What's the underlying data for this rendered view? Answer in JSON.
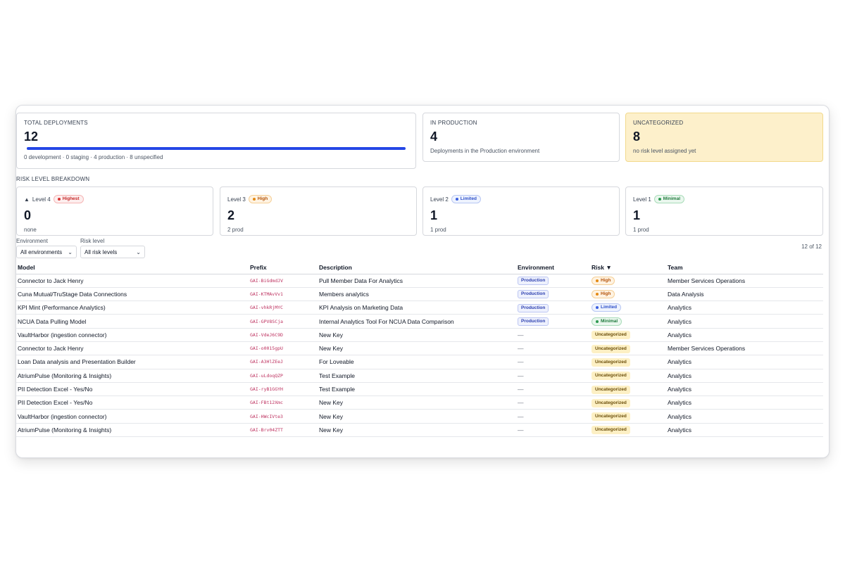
{
  "stats": {
    "total": {
      "label": "TOTAL DEPLOYMENTS",
      "value": "12",
      "progress": 1.0,
      "breakdown": "0 development · 0 staging · 4 production · 8 unspecified"
    },
    "production": {
      "label": "IN PRODUCTION",
      "value": "4",
      "sub": "Deployments in the Production environment"
    },
    "uncategorized": {
      "label": "UNCATEGORIZED",
      "value": "8",
      "sub": "no risk level assigned yet"
    }
  },
  "risk": {
    "title": "RISK LEVEL BREAKDOWN",
    "levels": [
      {
        "name": "Level 4",
        "badge": "Highest",
        "count": "0",
        "sub": "none"
      },
      {
        "name": "Level 3",
        "badge": "High",
        "count": "2",
        "sub": "2 prod"
      },
      {
        "name": "Level 2",
        "badge": "Limited",
        "count": "1",
        "sub": "1 prod"
      },
      {
        "name": "Level 1",
        "badge": "Minimal",
        "count": "1",
        "sub": "1 prod"
      }
    ]
  },
  "filters": {
    "environment": {
      "label": "Environment",
      "value": "All environments"
    },
    "risk": {
      "label": "Risk level",
      "value": "All risk levels"
    },
    "count": "12 of 12"
  },
  "table": {
    "headers": [
      "Model",
      "Prefix",
      "Description",
      "Environment",
      "Risk ▼",
      "Team"
    ],
    "rows": [
      {
        "model": "Connector to Jack Henry",
        "prefix": "GAI-BiGdmdJV",
        "description": "Pull Member Data For Analytics",
        "environment": "Production",
        "risk": "High",
        "risk_kind": "orange",
        "team": "Member Services Operations"
      },
      {
        "model": "Cuna Mutual/TruStage Data Connections",
        "prefix": "GAI-KTMAvVv1",
        "description": "Members analytics",
        "environment": "Production",
        "risk": "High",
        "risk_kind": "orange",
        "team": "Data Analysis"
      },
      {
        "model": "KPI Mint (Performance Analytics)",
        "prefix": "GAI-vhkRjMYC",
        "description": "KPI Analysis on Marketing Data",
        "environment": "Production",
        "risk": "Limited",
        "risk_kind": "blue",
        "team": "Analytics"
      },
      {
        "model": "NCUA Data Pulling Model",
        "prefix": "GAI-GPV8SCja",
        "description": "Internal Analytics Tool For NCUA Data Comparison",
        "environment": "Production",
        "risk": "Minimal",
        "risk_kind": "green",
        "team": "Analytics"
      },
      {
        "model": "VaultHarbor (ingestion connector)",
        "prefix": "GAI-VdeJ6C9D",
        "description": "New Key",
        "environment": "—",
        "risk": "Uncategorized",
        "risk_kind": "uncat",
        "team": "Analytics"
      },
      {
        "model": "Connector to Jack Henry",
        "prefix": "GAI-o0015gpU",
        "description": "New Key",
        "environment": "—",
        "risk": "Uncategorized",
        "risk_kind": "uncat",
        "team": "Member Services Operations"
      },
      {
        "model": "Loan Data analysis and Presentation Builder",
        "prefix": "GAI-A3HlZEeJ",
        "description": "For Loveable",
        "environment": "—",
        "risk": "Uncategorized",
        "risk_kind": "uncat",
        "team": "Analytics"
      },
      {
        "model": "AtriumPulse (Monitoring & Insights)",
        "prefix": "GAI-uLdoqQZP",
        "description": "Test Example",
        "environment": "—",
        "risk": "Uncategorized",
        "risk_kind": "uncat",
        "team": "Analytics"
      },
      {
        "model": "PII Detection Excel - Yes/No",
        "prefix": "GAI-ryB1GGYH",
        "description": "Test Example",
        "environment": "—",
        "risk": "Uncategorized",
        "risk_kind": "uncat",
        "team": "Analytics"
      },
      {
        "model": "PII Detection Excel - Yes/No",
        "prefix": "GAI-FBt12Xmc",
        "description": "New Key",
        "environment": "—",
        "risk": "Uncategorized",
        "risk_kind": "uncat",
        "team": "Analytics"
      },
      {
        "model": "VaultHarbor (ingestion connector)",
        "prefix": "GAI-HWcIVte3",
        "description": "New Key",
        "environment": "—",
        "risk": "Uncategorized",
        "risk_kind": "uncat",
        "team": "Analytics"
      },
      {
        "model": "AtriumPulse (Monitoring & Insights)",
        "prefix": "GAI-Brv04ZTT",
        "description": "New Key",
        "environment": "—",
        "risk": "Uncategorized",
        "risk_kind": "uncat",
        "team": "Analytics"
      }
    ]
  },
  "colors": {
    "accent": "#2547e6",
    "warn_bg": "#fdf0cb"
  },
  "icons": {
    "level4": "warning-triangle-icon",
    "chevron": "chevron-down-icon"
  }
}
